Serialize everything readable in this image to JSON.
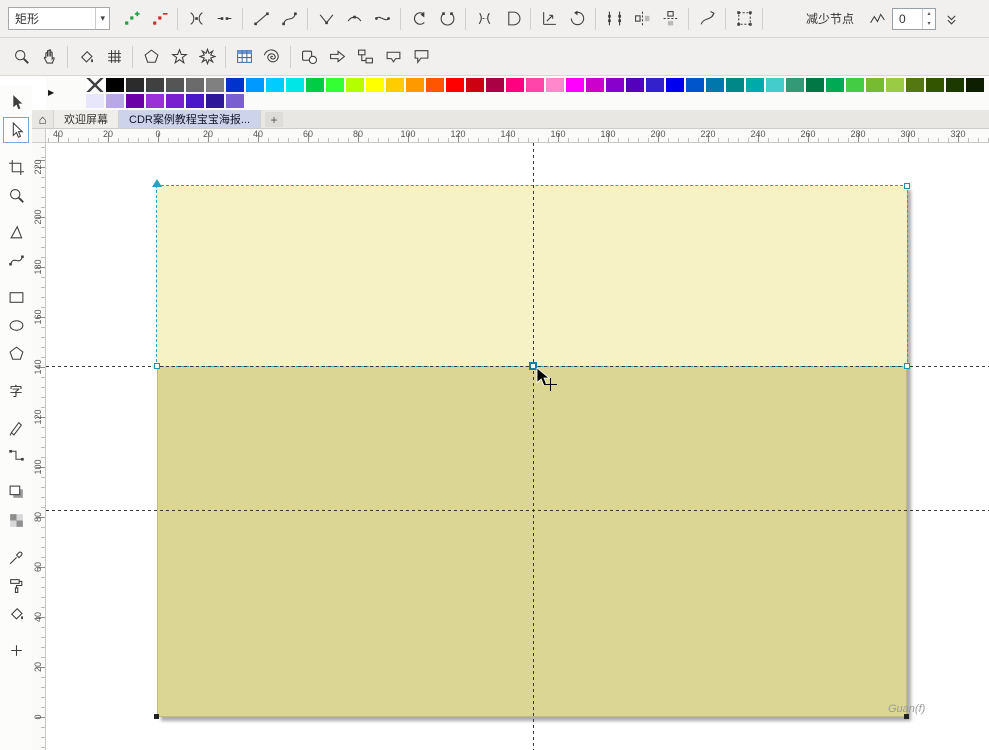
{
  "property_bar": {
    "shape_type": {
      "value": "矩形",
      "arrow": "▾"
    },
    "buttons": [
      {
        "name": "add-node-button",
        "icon": "node-add"
      },
      {
        "name": "delete-node-button",
        "icon": "node-delete"
      },
      {
        "sep": true
      },
      {
        "name": "join-nodes-button",
        "icon": "nodes-join"
      },
      {
        "name": "break-curve-button",
        "icon": "curve-break"
      },
      {
        "sep": true
      },
      {
        "name": "convert-to-line-button",
        "icon": "to-line"
      },
      {
        "name": "convert-to-curve-button",
        "icon": "to-curve"
      },
      {
        "sep": true
      },
      {
        "name": "cusp-node-button",
        "icon": "node-cusp"
      },
      {
        "name": "smooth-node-button",
        "icon": "node-smooth"
      },
      {
        "name": "symmetrical-node-button",
        "icon": "node-symmetric"
      },
      {
        "sep": true
      },
      {
        "name": "reverse-direction-button",
        "icon": "reverse"
      },
      {
        "name": "close-curve-button",
        "icon": "close-curve"
      },
      {
        "sep": true
      },
      {
        "name": "extract-subpath-button",
        "icon": "extract-subpath"
      },
      {
        "name": "extend-curve-close-button",
        "icon": "close-shape"
      },
      {
        "sep": true
      },
      {
        "name": "stretch-nodes-button",
        "icon": "stretch-nodes"
      },
      {
        "name": "rotate-skew-nodes-button",
        "icon": "rotate-nodes"
      },
      {
        "sep": true
      },
      {
        "name": "align-nodes-button",
        "icon": "align-nodes"
      },
      {
        "name": "reflect-horizontal-button",
        "icon": "reflect-h"
      },
      {
        "name": "reflect-vertical-button",
        "icon": "reflect-v"
      },
      {
        "sep": true
      },
      {
        "name": "elastic-mode-button",
        "icon": "elastic"
      },
      {
        "sep": true
      },
      {
        "name": "select-all-nodes-button",
        "icon": "select-all"
      },
      {
        "sep": true
      }
    ],
    "reduce_nodes_label": "减少节点",
    "curve_smoothness": {
      "value": "0",
      "spin_up": "▴",
      "spin_down": "▾"
    }
  },
  "toolbar_secondary": {
    "buttons": [
      {
        "name": "zoom-tool-button",
        "icon": "zoom"
      },
      {
        "name": "pan-tool-button",
        "icon": "hand"
      },
      {
        "sep": true
      },
      {
        "name": "smart-fill-tool-button",
        "icon": "bucket"
      },
      {
        "name": "graph-paper-tool-button",
        "icon": "grid"
      },
      {
        "sep": true
      },
      {
        "name": "polygon-tool-button",
        "icon": "polygon"
      },
      {
        "name": "star-tool-button",
        "icon": "star"
      },
      {
        "name": "complex-star-tool-button",
        "icon": "complex-star"
      },
      {
        "sep": true
      },
      {
        "name": "table-tool-button",
        "icon": "table"
      },
      {
        "name": "spiral-tool-button",
        "icon": "spiral"
      },
      {
        "sep": true
      },
      {
        "name": "basic-shapes-button",
        "icon": "basic-shapes"
      },
      {
        "name": "arrow-shapes-button",
        "icon": "arrow"
      },
      {
        "name": "flowchart-shapes-button",
        "icon": "flowchart"
      },
      {
        "name": "banner-shapes-button",
        "icon": "banner"
      },
      {
        "name": "callout-shapes-button",
        "icon": "callout"
      }
    ]
  },
  "color_palette": {
    "flyout_arrow": "▶",
    "row1": [
      "none",
      "#000000",
      "#2b2b2b",
      "#404040",
      "#555555",
      "#6b6b6b",
      "#808080",
      "#0033cc",
      "#0099ff",
      "#00ccff",
      "#00e6e6",
      "#00cc44",
      "#33ff33",
      "#b3ff00",
      "#ffff00",
      "#ffcc00",
      "#ff9900",
      "#ff5500",
      "#ff0000",
      "#cc0011",
      "#aa0044",
      "#ff0080",
      "#ff44aa",
      "#ff88cc",
      "#ff00ff",
      "#cc00cc",
      "#8800cc",
      "#5500bb",
      "#3322cc",
      "#0000ee",
      "#0055cc",
      "#0077aa",
      "#008888",
      "#00aaaa",
      "#44cccc",
      "#339977",
      "#007744",
      "#00aa55",
      "#44cc44",
      "#77bb33",
      "#99cc44",
      "#557711",
      "#335500",
      "#1c3a00",
      "#0d1f00"
    ],
    "row2": [
      "#e8e6fa",
      "#b8a8e8",
      "#6a00a8",
      "#9b30d9",
      "#7a1fd0",
      "#4a18c8",
      "#2e1798",
      "#7a5fd0"
    ]
  },
  "tab_bar": {
    "home_icon": "⌂",
    "tabs": [
      {
        "label": "欢迎屏幕",
        "active": false
      },
      {
        "label": "CDR案例教程宝宝海报...",
        "active": true
      }
    ],
    "new_tab_label": "+"
  },
  "rulers": {
    "horizontal_labels": [
      "40",
      "20",
      "0",
      "20",
      "40",
      "60",
      "80",
      "100",
      "120",
      "140",
      "160",
      "180",
      "200",
      "220",
      "240",
      "260",
      "280",
      "300",
      "320"
    ],
    "vertical_labels": [
      "220",
      "200",
      "180",
      "160",
      "140",
      "120",
      "100",
      "80",
      "60",
      "40",
      "20",
      "0"
    ]
  },
  "toolbox": {
    "tools": [
      {
        "name": "pick-tool",
        "icon": "pointer"
      },
      {
        "name": "shape-tool",
        "icon": "shape-arrow",
        "active": true
      },
      {
        "gap": true
      },
      {
        "name": "crop-tool",
        "icon": "crop"
      },
      {
        "name": "zoom-tool",
        "icon": "zoom"
      },
      {
        "gap": true
      },
      {
        "name": "freehand-tool",
        "icon": "triangle"
      },
      {
        "name": "artistic-media-tool",
        "icon": "curve"
      },
      {
        "gap": true
      },
      {
        "name": "rectangle-tool",
        "icon": "rect"
      },
      {
        "name": "ellipse-tool",
        "icon": "ellipse"
      },
      {
        "name": "polygon-tool",
        "icon": "polygon"
      },
      {
        "gap": true
      },
      {
        "name": "text-tool",
        "label": "字"
      },
      {
        "gap": true
      },
      {
        "name": "pen-tool",
        "icon": "pen"
      },
      {
        "name": "connector-tool",
        "icon": "connector"
      },
      {
        "gap": true
      },
      {
        "name": "drop-shadow-tool",
        "icon": "shadow"
      },
      {
        "name": "transparency-tool",
        "icon": "checker"
      },
      {
        "gap": true
      },
      {
        "name": "color-eyedropper-tool",
        "icon": "dropper"
      },
      {
        "name": "fill-tool",
        "icon": "roller"
      },
      {
        "name": "interactive-fill-tool",
        "icon": "bucket"
      },
      {
        "gap": true
      },
      {
        "name": "toolbox-customize-button",
        "icon": "plus"
      }
    ]
  },
  "canvas": {
    "watermark": "Guan(f)",
    "rect_top_fill": "#f6f2c6",
    "rect_bottom_fill": "#dcd695",
    "selection_color": "#2ba2b8",
    "guide_color": "#3a3a3a"
  }
}
